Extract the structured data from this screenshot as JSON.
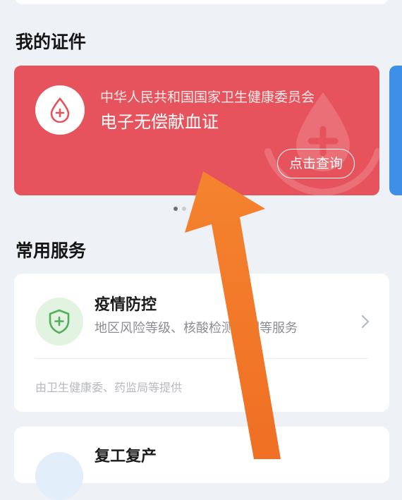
{
  "sections": {
    "my_certificates": "我的证件",
    "common_services": "常用服务"
  },
  "certificate": {
    "issuer": "中华人民共和国国家卫生健康委员会",
    "name": "电子无偿献血证",
    "query_button": "点击查询",
    "icon": "blood-drop-icon",
    "background_color": "#e6535c",
    "carousel": {
      "total": 2,
      "active": 1
    }
  },
  "services": [
    {
      "title": "疫情防控",
      "description": "地区风险等级、核酸检测证明等服务",
      "provider": "由卫生健康委、药监局等提供",
      "icon": "shield-plus-icon",
      "icon_color": "#52b05a"
    },
    {
      "title": "复工复产"
    }
  ],
  "annotation": {
    "type": "arrow",
    "color": "#f47b2a",
    "icon": "pointer-arrow-icon"
  }
}
